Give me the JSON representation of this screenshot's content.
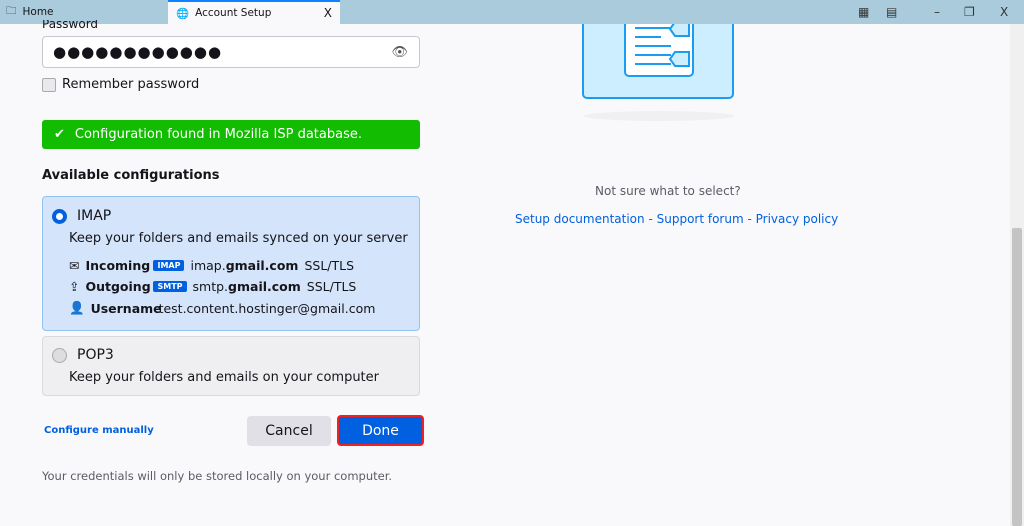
{
  "tabs": {
    "home": "Home",
    "active": "Account Setup",
    "close": "X"
  },
  "window": {
    "minimize": "–",
    "restore": "❐",
    "close": "X"
  },
  "form": {
    "password_label": "Password",
    "password_value": "●●●●●●●●●●●●",
    "remember_label": "Remember password"
  },
  "banner": "Configuration found in Mozilla ISP database.",
  "configs": {
    "heading": "Available configurations",
    "imap": {
      "title": "IMAP",
      "desc": "Keep your folders and emails synced on your server",
      "incoming_label": "Incoming",
      "incoming_badge": "IMAP",
      "incoming_host_pre": "imap.",
      "incoming_host_bold": "gmail.com",
      "incoming_sec": "SSL/TLS",
      "outgoing_label": "Outgoing",
      "outgoing_badge": "SMTP",
      "outgoing_host_pre": "smtp.",
      "outgoing_host_bold": "gmail.com",
      "outgoing_sec": "SSL/TLS",
      "username_label": "Username",
      "username_value": "test.content.hostinger@gmail.com"
    },
    "pop3": {
      "title": "POP3",
      "desc": "Keep your folders and emails on your computer"
    }
  },
  "actions": {
    "configure_manually": "Configure manually",
    "cancel": "Cancel",
    "done": "Done"
  },
  "footer_note": "Your credentials will only be stored locally on your computer.",
  "help": {
    "question": "Not sure what to select?",
    "setup_doc": "Setup documentation",
    "sep": " - ",
    "support": "Support forum",
    "privacy": "Privacy policy"
  }
}
